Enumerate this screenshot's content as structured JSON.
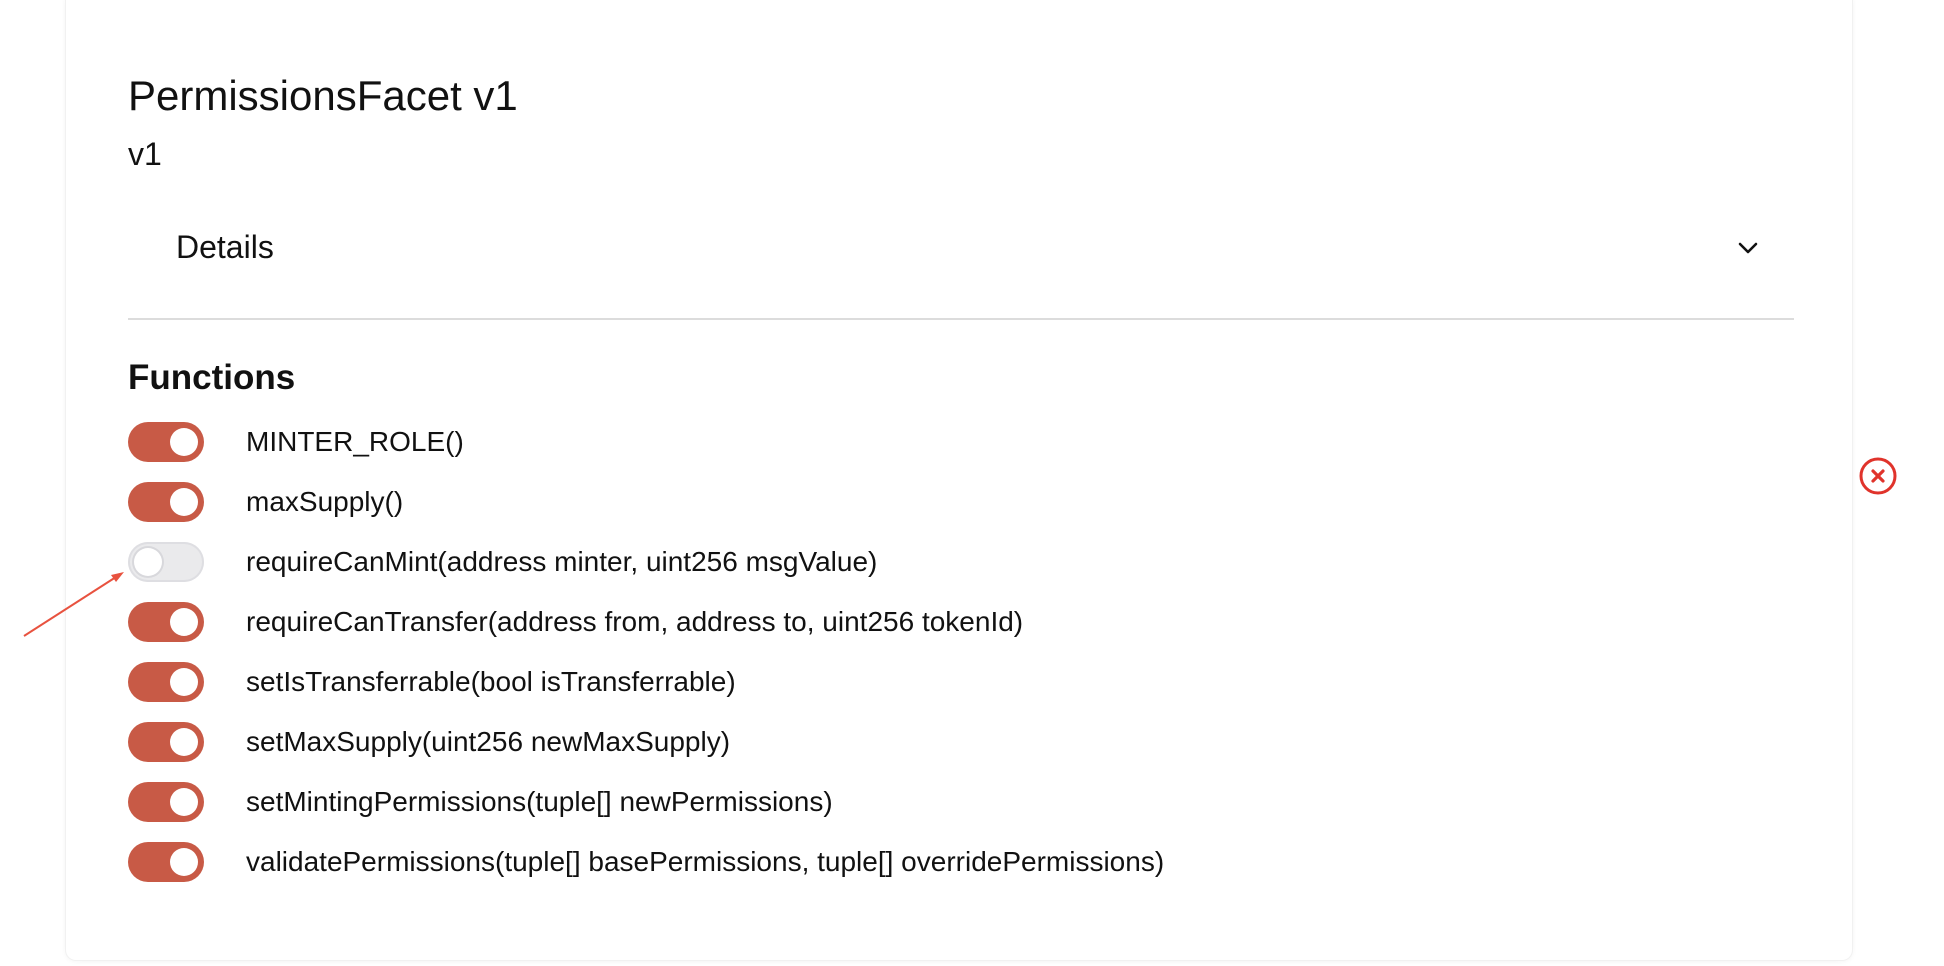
{
  "header": {
    "title": "PermissionsFacet v1",
    "version": "v1"
  },
  "details": {
    "label": "Details",
    "chevron_icon": "chevron-down-icon"
  },
  "functions": {
    "heading": "Functions",
    "items": [
      {
        "label": "MINTER_ROLE()",
        "enabled": true
      },
      {
        "label": "maxSupply()",
        "enabled": true
      },
      {
        "label": "requireCanMint(address minter, uint256 msgValue)",
        "enabled": false
      },
      {
        "label": "requireCanTransfer(address from, address to, uint256 tokenId)",
        "enabled": true
      },
      {
        "label": "setIsTransferrable(bool isTransferrable)",
        "enabled": true
      },
      {
        "label": "setMaxSupply(uint256 newMaxSupply)",
        "enabled": true
      },
      {
        "label": "setMintingPermissions(tuple[] newPermissions)",
        "enabled": true
      },
      {
        "label": "validatePermissions(tuple[] basePermissions, tuple[] overridePermissions)",
        "enabled": true
      }
    ]
  },
  "remove_button": {
    "icon": "close-circle-icon"
  },
  "annotation": {
    "icon": "arrow-icon"
  },
  "colors": {
    "toggle_on": "#c85a46",
    "toggle_off": "#eaeaec",
    "remove_icon": "#e0332b",
    "annotation_arrow": "#e8523f"
  }
}
